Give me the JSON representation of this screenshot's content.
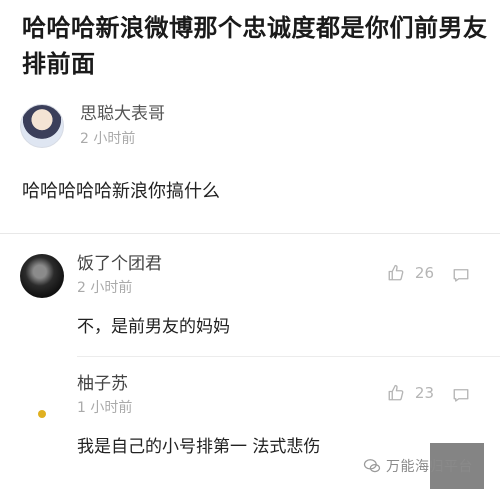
{
  "post": {
    "title": "哈哈哈新浪微博那个忠诚度都是你们前男友排前面",
    "author_name": "思聪大表哥",
    "author_time": "2 小时前",
    "body": "哈哈哈哈哈新浪你搞什么"
  },
  "comments": [
    {
      "name": "饭了个团君",
      "time": "2 小时前",
      "text": "不，是前男友的妈妈",
      "likes": "26"
    },
    {
      "name": "柚子苏",
      "time": "1 小时前",
      "text": "我是自己的小号排第一 法式悲伤",
      "likes": "23"
    }
  ],
  "watermark": {
    "text": "万能海归平台"
  },
  "icons": {
    "like": "thumbs-up-icon",
    "reply": "comment-bubble-icon",
    "watermark": "wechat-icon"
  },
  "colors": {
    "icon_gray": "#b5b5b5",
    "time_gray": "#aaaaaa",
    "separator": "#e8e8e8"
  }
}
